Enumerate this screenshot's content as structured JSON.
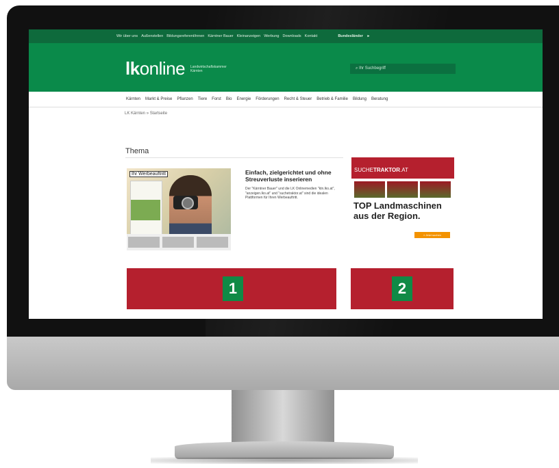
{
  "topbar": {
    "links": [
      "Wir über uns",
      "Außenstellen",
      "Bildungsreferent/innen",
      "Kärntner Bauer",
      "Kleinanzeigen",
      "Werbung",
      "Downloads",
      "Kontakt"
    ],
    "bundeslaender": "Bundesländer"
  },
  "header": {
    "logo_bold": "lk",
    "logo_rest": "online",
    "tagline_1": "Landwirtschaftskammer",
    "tagline_2": "Kärnten",
    "search_placeholder": "Ihr Suchbegriff"
  },
  "mainnav": [
    "Kärnten",
    "Markt & Preise",
    "Pflanzen",
    "Tiere",
    "Forst",
    "Bio",
    "Energie",
    "Förderungen",
    "Recht & Steuer",
    "Betrieb & Familie",
    "Bildung",
    "Beratung"
  ],
  "breadcrumb": "LK Kärnten » Startseite",
  "section_title": "Thema",
  "ad": {
    "badge": "Ihr Werbeauftritt",
    "headline": "Einfach, zielgerichtet und ohne Streuverluste inserieren",
    "body": "Der \"Kärntner Bauer\" und die LK Onlinemedien \"ktn.lko.at\", \"anzeigen.lko.at\" und \"suchetraktor.at\" sind die idealen Plattformen für Ihren Werbeauftritt."
  },
  "traktor_ad": {
    "brand_pre": "SUCHE",
    "brand_main": "TRAKTOR",
    "brand_suffix": ".AT",
    "headline": "TOP Landmaschinen aus der Region.",
    "button": "» Jetzt suchen"
  },
  "placeholders": [
    "1",
    "2"
  ],
  "colors": {
    "green_dark": "#0e6a3c",
    "green": "#0a8a4a",
    "red": "#b5202e",
    "orange": "#f39200"
  }
}
